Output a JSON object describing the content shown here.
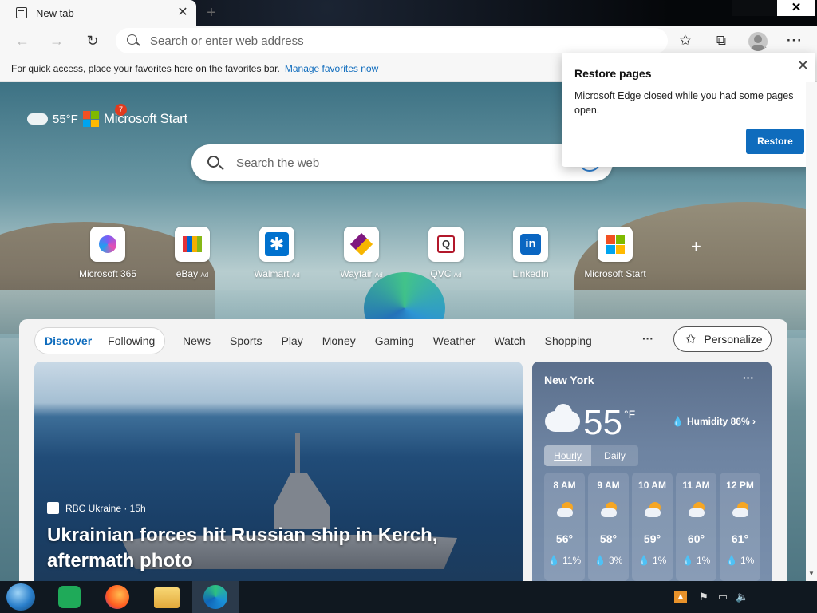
{
  "browser": {
    "tab_title": "New tab",
    "tab_close": "✕",
    "new_tab": "+",
    "address_placeholder": "Search or enter web address",
    "back": "←",
    "forward": "→",
    "refresh": "↻",
    "more": "···",
    "window_close": "✕"
  },
  "favorites_bar": {
    "message": "For quick access, place your favorites here on the favorites bar.",
    "link": "Manage favorites now"
  },
  "restore_popup": {
    "title": "Restore pages",
    "message": "Microsoft Edge closed while you had some pages open.",
    "button": "Restore",
    "close": "✕"
  },
  "ntp": {
    "weather_temp": "55°F",
    "brand": "Microsoft Start",
    "notification_count": "7",
    "search_placeholder": "Search the web",
    "quick_links": [
      {
        "label": "Microsoft 365",
        "ad": ""
      },
      {
        "label": "eBay",
        "ad": "Ad"
      },
      {
        "label": "Walmart",
        "ad": "Ad"
      },
      {
        "label": "Wayfair",
        "ad": "Ad"
      },
      {
        "label": "QVC",
        "ad": "Ad"
      },
      {
        "label": "LinkedIn",
        "ad": ""
      },
      {
        "label": "Microsoft Start",
        "ad": ""
      }
    ],
    "add_link": "+"
  },
  "feed": {
    "pill_tabs": [
      "Discover",
      "Following"
    ],
    "categories": [
      "News",
      "Sports",
      "Play",
      "Money",
      "Gaming",
      "Weather",
      "Watch",
      "Shopping"
    ],
    "more": "···",
    "personalize": "Personalize",
    "hero": {
      "source": "RBC Ukraine · 15h",
      "title": "Ukrainian forces hit Russian ship in Kerch, aftermath photo"
    }
  },
  "weather": {
    "city": "New York",
    "temp": "55",
    "unit": "°F",
    "humidity": "Humidity 86%",
    "more": "···",
    "tabs": [
      "Hourly",
      "Daily"
    ],
    "hours": [
      {
        "time": "8 AM",
        "temp": "56°",
        "precip": "11%"
      },
      {
        "time": "9 AM",
        "temp": "58°",
        "precip": "3%"
      },
      {
        "time": "10 AM",
        "temp": "59°",
        "precip": "1%"
      },
      {
        "time": "11 AM",
        "temp": "60°",
        "precip": "1%"
      },
      {
        "time": "12 PM",
        "temp": "61°",
        "precip": "1%"
      }
    ]
  },
  "colors": {
    "accent": "#0f6cbd",
    "taskbar": "#101820"
  }
}
